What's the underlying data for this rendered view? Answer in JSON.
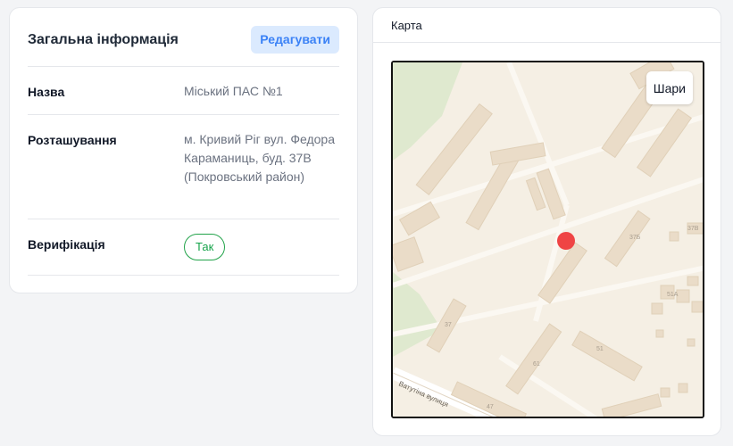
{
  "info_card": {
    "title": "Загальна інформація",
    "edit_label": "Редагувати",
    "rows": [
      {
        "label": "Назва",
        "value": "Міський ПАС №1"
      },
      {
        "label": "Розташування",
        "value": "м. Кривий Ріг вул. Федора Караманиць, буд. 37В (Покровський район)"
      },
      {
        "label": "Верифікація",
        "value": "Так"
      }
    ]
  },
  "map_card": {
    "title": "Карта",
    "layers_label": "Шари",
    "street_label": "Ватутіна вулиця",
    "house_numbers": [
      "37",
      "37Б",
      "37В",
      "61",
      "47",
      "51",
      "51А"
    ],
    "marker_color": "#ef4444"
  },
  "colors": {
    "accent": "#3b82f6",
    "accent_bg": "#dbeafe",
    "success": "#16a34a",
    "map_background": "#f5efe4",
    "map_building": "#eadcc8",
    "map_park": "#dfe9cf"
  }
}
